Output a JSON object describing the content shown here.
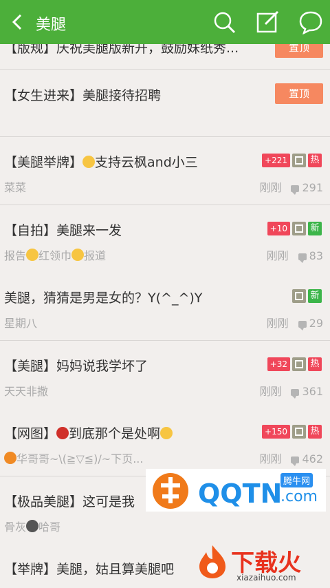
{
  "header": {
    "title": "美腿",
    "back_icon": "back-arrow-icon",
    "icons": [
      "search-icon",
      "compose-icon",
      "chat-icon"
    ],
    "bg_color": "#4caf3a"
  },
  "posts": [
    {
      "title": "【版规】庆祝美腿版新开，鼓励妹纸秀...",
      "pin": "置顶"
    },
    {
      "title": "【女生进来】美腿接待招聘",
      "pin": "置顶"
    },
    {
      "title_a": "【美腿举牌】",
      "title_b": "支持云枫and小三",
      "author": "菜菜",
      "time": "刚刚",
      "comments": "291",
      "plus": "+221",
      "tag": "热"
    },
    {
      "title": "【自拍】美腿来一发",
      "author_a": "报告",
      "author_b": "红领巾",
      "author_c": "报道",
      "time": "刚刚",
      "comments": "83",
      "plus": "+10",
      "tag": "新"
    },
    {
      "title": "美腿，猜猜是男是女的？Y(^_^)Y",
      "author": "星期八",
      "time": "刚刚",
      "comments": "29",
      "tag": "新"
    },
    {
      "title": "【美腿】妈妈说我学坏了",
      "author": "天天非撒",
      "time": "刚刚",
      "comments": "361",
      "plus": "+32",
      "tag": "热"
    },
    {
      "title_a": "【网图】",
      "title_b": "到底那个是处啊",
      "author": "华哥哥~\\(≧▽≦)/~下页...",
      "time": "刚刚",
      "comments": "462",
      "plus": "+150",
      "tag": "热"
    },
    {
      "title": "【极品美腿】这可是我",
      "author_a": "骨灰",
      "author_b": "哈哥"
    },
    {
      "title": "【举牌】美腿，姑且算美腿吧"
    }
  ],
  "watermarks": {
    "qqtn_small": "腾牛网",
    "qqtn_text": "QQTN",
    "qqtn_domain": ".com",
    "xzh_text": "下载火",
    "xzh_domain": "xiazaihuo.com"
  },
  "colors": {
    "hot": "#f0475a",
    "new": "#3cb54a",
    "pin": "#f68860"
  }
}
